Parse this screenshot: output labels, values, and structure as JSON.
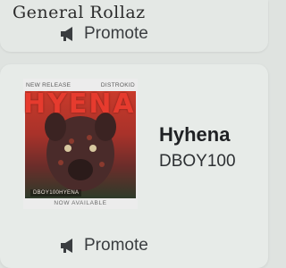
{
  "header": {
    "artist_name": "General Rollaz",
    "promote_label": "Promote"
  },
  "release": {
    "cover": {
      "tag_left": "NEW RELEASE",
      "tag_right": "DISTROKID",
      "title_art": "HYENA",
      "artist_tag": "DBOY100HYENA",
      "footer": "NOW AVAILABLE"
    },
    "title": "Hyhena",
    "artist": "DBOY100"
  },
  "footer": {
    "promote_label": "Promote"
  },
  "icons": {
    "promote": "megaphone-icon"
  },
  "colors": {
    "background": "#dfe3e0",
    "accent": "#e63b2e",
    "text": "#1f2124"
  }
}
